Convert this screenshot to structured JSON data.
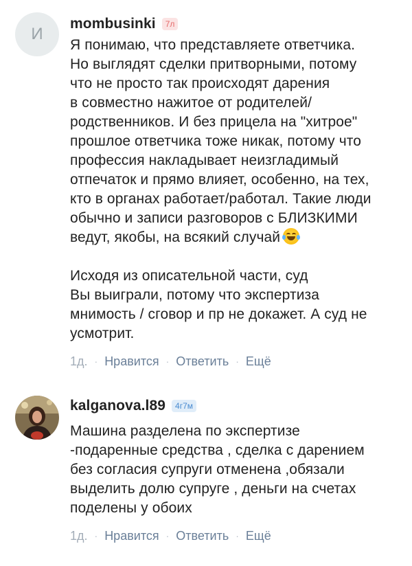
{
  "comments": [
    {
      "avatar_letter": "И",
      "username": "mombusinki",
      "badge": "7л",
      "text_main": "Я понимаю, что представляете ответчика.\nНо выглядят сделки притворными, потому\nчто не просто так происходят дарения\nв совместно нажитое от родителей/\nродственников. И без прицела на \"хитрое\"\nпрошлое ответчика тоже никак, потому что\nпрофессия накладывает неизгладимый\nотпечаток и прямо влияет, особенно, на тех,\nкто в органах работает/работал. Такие люди\nобычно и записи разговоров с БЛИЗКИМИ\nведут, якобы, на всякий случай",
      "emoji": "laughing-with-tears",
      "text_extra": "Исходя из описательной части, суд\nВы выиграли, потому что экспертиза\nмнимость / сговор и пр не докажет. А суд не\nусмотрит.",
      "time": "1д.",
      "like": "Нравится",
      "reply": "Ответить",
      "more": "Ещё"
    },
    {
      "username": "kalganova.l89",
      "badge": "4г7м",
      "text_main": "Машина разделена по экспертизе\n-подаренные средства , сделка с дарением\nбез согласия супруги отменена ,обязали\nвыделить долю супруге , деньги на счетах\nподелены у обоих",
      "time": "1д.",
      "like": "Нравится",
      "reply": "Ответить",
      "more": "Ещё"
    }
  ],
  "colors": {
    "badge_red_bg": "#fbe3e3",
    "badge_red_fg": "#e56b6b",
    "badge_blue_bg": "#e0edf9",
    "badge_blue_fg": "#4a8bd0",
    "link": "#6a7f98"
  },
  "separator": "·"
}
